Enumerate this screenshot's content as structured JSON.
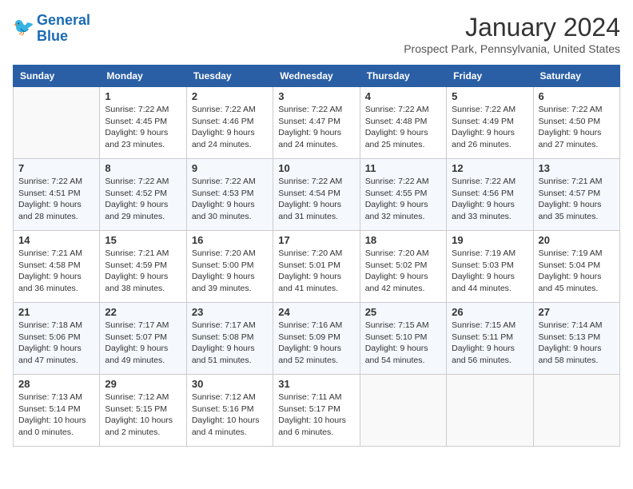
{
  "header": {
    "logo_line1": "General",
    "logo_line2": "Blue",
    "month": "January 2024",
    "location": "Prospect Park, Pennsylvania, United States"
  },
  "days_of_week": [
    "Sunday",
    "Monday",
    "Tuesday",
    "Wednesday",
    "Thursday",
    "Friday",
    "Saturday"
  ],
  "weeks": [
    [
      {
        "day": "",
        "info": ""
      },
      {
        "day": "1",
        "info": "Sunrise: 7:22 AM\nSunset: 4:45 PM\nDaylight: 9 hours\nand 23 minutes."
      },
      {
        "day": "2",
        "info": "Sunrise: 7:22 AM\nSunset: 4:46 PM\nDaylight: 9 hours\nand 24 minutes."
      },
      {
        "day": "3",
        "info": "Sunrise: 7:22 AM\nSunset: 4:47 PM\nDaylight: 9 hours\nand 24 minutes."
      },
      {
        "day": "4",
        "info": "Sunrise: 7:22 AM\nSunset: 4:48 PM\nDaylight: 9 hours\nand 25 minutes."
      },
      {
        "day": "5",
        "info": "Sunrise: 7:22 AM\nSunset: 4:49 PM\nDaylight: 9 hours\nand 26 minutes."
      },
      {
        "day": "6",
        "info": "Sunrise: 7:22 AM\nSunset: 4:50 PM\nDaylight: 9 hours\nand 27 minutes."
      }
    ],
    [
      {
        "day": "7",
        "info": "Sunrise: 7:22 AM\nSunset: 4:51 PM\nDaylight: 9 hours\nand 28 minutes."
      },
      {
        "day": "8",
        "info": "Sunrise: 7:22 AM\nSunset: 4:52 PM\nDaylight: 9 hours\nand 29 minutes."
      },
      {
        "day": "9",
        "info": "Sunrise: 7:22 AM\nSunset: 4:53 PM\nDaylight: 9 hours\nand 30 minutes."
      },
      {
        "day": "10",
        "info": "Sunrise: 7:22 AM\nSunset: 4:54 PM\nDaylight: 9 hours\nand 31 minutes."
      },
      {
        "day": "11",
        "info": "Sunrise: 7:22 AM\nSunset: 4:55 PM\nDaylight: 9 hours\nand 32 minutes."
      },
      {
        "day": "12",
        "info": "Sunrise: 7:22 AM\nSunset: 4:56 PM\nDaylight: 9 hours\nand 33 minutes."
      },
      {
        "day": "13",
        "info": "Sunrise: 7:21 AM\nSunset: 4:57 PM\nDaylight: 9 hours\nand 35 minutes."
      }
    ],
    [
      {
        "day": "14",
        "info": "Sunrise: 7:21 AM\nSunset: 4:58 PM\nDaylight: 9 hours\nand 36 minutes."
      },
      {
        "day": "15",
        "info": "Sunrise: 7:21 AM\nSunset: 4:59 PM\nDaylight: 9 hours\nand 38 minutes."
      },
      {
        "day": "16",
        "info": "Sunrise: 7:20 AM\nSunset: 5:00 PM\nDaylight: 9 hours\nand 39 minutes."
      },
      {
        "day": "17",
        "info": "Sunrise: 7:20 AM\nSunset: 5:01 PM\nDaylight: 9 hours\nand 41 minutes."
      },
      {
        "day": "18",
        "info": "Sunrise: 7:20 AM\nSunset: 5:02 PM\nDaylight: 9 hours\nand 42 minutes."
      },
      {
        "day": "19",
        "info": "Sunrise: 7:19 AM\nSunset: 5:03 PM\nDaylight: 9 hours\nand 44 minutes."
      },
      {
        "day": "20",
        "info": "Sunrise: 7:19 AM\nSunset: 5:04 PM\nDaylight: 9 hours\nand 45 minutes."
      }
    ],
    [
      {
        "day": "21",
        "info": "Sunrise: 7:18 AM\nSunset: 5:06 PM\nDaylight: 9 hours\nand 47 minutes."
      },
      {
        "day": "22",
        "info": "Sunrise: 7:17 AM\nSunset: 5:07 PM\nDaylight: 9 hours\nand 49 minutes."
      },
      {
        "day": "23",
        "info": "Sunrise: 7:17 AM\nSunset: 5:08 PM\nDaylight: 9 hours\nand 51 minutes."
      },
      {
        "day": "24",
        "info": "Sunrise: 7:16 AM\nSunset: 5:09 PM\nDaylight: 9 hours\nand 52 minutes."
      },
      {
        "day": "25",
        "info": "Sunrise: 7:15 AM\nSunset: 5:10 PM\nDaylight: 9 hours\nand 54 minutes."
      },
      {
        "day": "26",
        "info": "Sunrise: 7:15 AM\nSunset: 5:11 PM\nDaylight: 9 hours\nand 56 minutes."
      },
      {
        "day": "27",
        "info": "Sunrise: 7:14 AM\nSunset: 5:13 PM\nDaylight: 9 hours\nand 58 minutes."
      }
    ],
    [
      {
        "day": "28",
        "info": "Sunrise: 7:13 AM\nSunset: 5:14 PM\nDaylight: 10 hours\nand 0 minutes."
      },
      {
        "day": "29",
        "info": "Sunrise: 7:12 AM\nSunset: 5:15 PM\nDaylight: 10 hours\nand 2 minutes."
      },
      {
        "day": "30",
        "info": "Sunrise: 7:12 AM\nSunset: 5:16 PM\nDaylight: 10 hours\nand 4 minutes."
      },
      {
        "day": "31",
        "info": "Sunrise: 7:11 AM\nSunset: 5:17 PM\nDaylight: 10 hours\nand 6 minutes."
      },
      {
        "day": "",
        "info": ""
      },
      {
        "day": "",
        "info": ""
      },
      {
        "day": "",
        "info": ""
      }
    ]
  ]
}
